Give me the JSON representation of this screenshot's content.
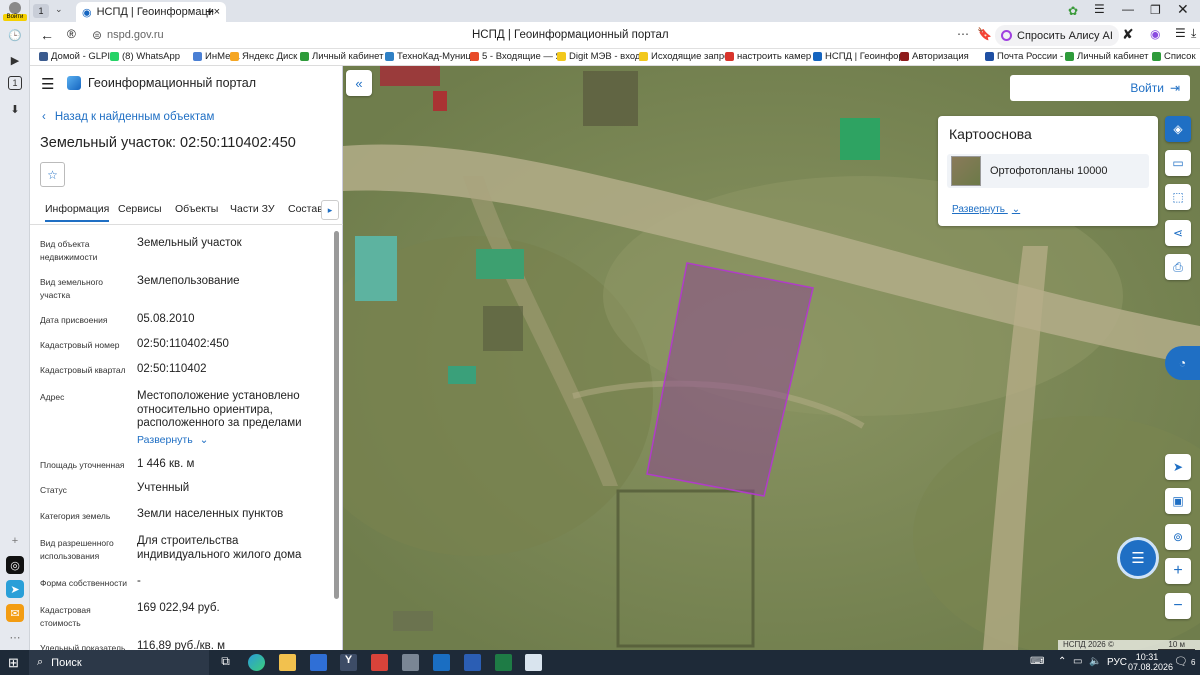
{
  "browser": {
    "tab_count": "1",
    "tab_title": "НСПД | Геоинформаци",
    "url": "nspd.gov.ru",
    "page_title": "НСПД | Геоинформационный портал",
    "alice_button": "Спросить Алису AI",
    "login_badge": "Войти"
  },
  "bookmarks": [
    {
      "label": "Домой - GLPI",
      "color": "#3b5b8f"
    },
    {
      "label": "(8) WhatsApp",
      "color": "#25d366"
    },
    {
      "label": "ИнМета",
      "color": "#4a7fd4"
    },
    {
      "label": "Яндекс Диск",
      "color": "#f5a623"
    },
    {
      "label": "Личный кабинет",
      "color": "#2e9b3a"
    },
    {
      "label": "ТехноКад-Муниц",
      "color": "#2f80c5"
    },
    {
      "label": "5 - Входящие — Я",
      "color": "#e84b2a"
    },
    {
      "label": "Digit МЭВ - вход",
      "color": "#f2c81c"
    },
    {
      "label": "Исходящие запро",
      "color": "#f2c81c"
    },
    {
      "label": "настроить камер",
      "color": "#d9342b"
    },
    {
      "label": "НСПД | Геоинфор",
      "color": "#1565c0"
    },
    {
      "label": "Авторизация",
      "color": "#8e1c1c"
    },
    {
      "label": "Почта России - М",
      "color": "#1f4fa3"
    },
    {
      "label": "Личный кабинет",
      "color": "#2e9b3a"
    },
    {
      "label": "Список",
      "color": "#2e9b3a"
    }
  ],
  "panel": {
    "app_title": "Геоинформационный портал",
    "back_link": "Назад к найденным объектам",
    "object_title": "Земельный участок: 02:50:110402:450",
    "tabs": [
      "Информация",
      "Сервисы",
      "Объекты",
      "Части ЗУ",
      "Состав"
    ],
    "rows": [
      {
        "label": "Вид объекта недвижимости",
        "value": "Земельный участок"
      },
      {
        "label": "Вид земельного участка",
        "value": "Землепользование"
      },
      {
        "label": "Дата присвоения",
        "value": "05.08.2010"
      },
      {
        "label": "Кадастровый номер",
        "value": "02:50:110402:450"
      },
      {
        "label": "Кадастровый квартал",
        "value": "02:50:110402"
      },
      {
        "label": "Адрес",
        "value": "Местоположение установлено относительно ориентира, расположенного за пределами"
      },
      {
        "label": "Площадь уточненная",
        "value": "1 446 кв. м"
      },
      {
        "label": "Статус",
        "value": "Учтенный"
      },
      {
        "label": "Категория земель",
        "value": "Земли населенных пунктов"
      },
      {
        "label": "Вид разрешенного использования",
        "value": "Для строительства индивидуального жилого дома"
      },
      {
        "label": "Форма собственности",
        "value": "-"
      },
      {
        "label": "Кадастровая стоимость",
        "value": "169 022,94 руб."
      },
      {
        "label": "Удельный показатель",
        "value": "116,89 руб./кв. м"
      }
    ],
    "expand_link": "Развернуть"
  },
  "map": {
    "login_button": "Войти",
    "basemap_title": "Картооснова",
    "basemap_item": "Ортофотопланы 10000",
    "basemap_expand": "Развернуть",
    "attribution": "НСПД 2026 ©",
    "scale": "10 м",
    "parcel_color": "#b03cc8"
  },
  "taskbar": {
    "search_label": "Поиск",
    "language": "РУС",
    "time": "10:31",
    "date": "07.08.2026",
    "notifications": "6"
  }
}
